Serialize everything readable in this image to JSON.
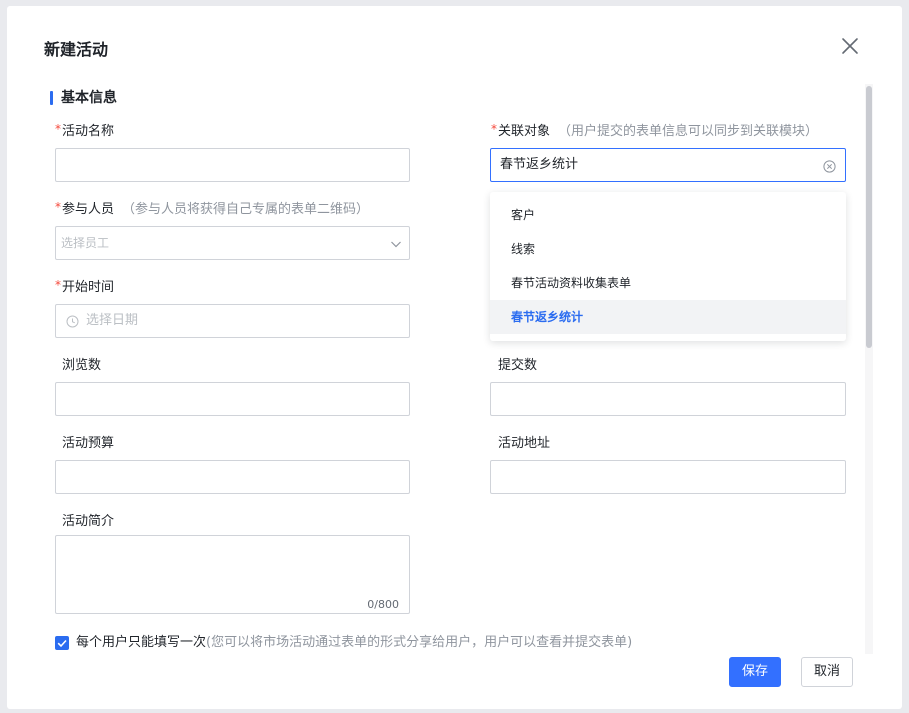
{
  "dialog": {
    "title": "新建活动",
    "close_icon": "close-icon"
  },
  "section": {
    "title": "基本信息"
  },
  "fields": {
    "activity_name": {
      "label": "活动名称",
      "value": ""
    },
    "related_object": {
      "label": "关联对象",
      "hint": "（用户提交的表单信息可以同步到关联模块）",
      "value": "春节返乡统计"
    },
    "participants": {
      "label": "参与人员",
      "hint": "（参与人员将获得自己专属的表单二维码）",
      "placeholder": "选择员工"
    },
    "start_time": {
      "label": "开始时间",
      "placeholder": "选择日期"
    },
    "views": {
      "label": "浏览数",
      "value": ""
    },
    "submissions": {
      "label": "提交数",
      "value": ""
    },
    "budget": {
      "label": "活动预算",
      "value": ""
    },
    "address": {
      "label": "活动地址",
      "value": ""
    },
    "intro": {
      "label": "活动简介",
      "value": "",
      "counter": "0/800"
    }
  },
  "dropdown": {
    "items": [
      "客户",
      "线索",
      "春节活动资料收集表单",
      "春节返乡统计"
    ],
    "selected": "春节返乡统计"
  },
  "once_per_user": {
    "checked": true,
    "label": "每个用户只能填写一次",
    "hint": "(您可以将市场活动通过表单的形式分享给用户，用户可以查看并提交表单)"
  },
  "buttons": {
    "save": "保存",
    "cancel": "取消"
  },
  "colors": {
    "accent": "#3370ff",
    "required": "#f5483b",
    "hint": "#8f959e"
  }
}
